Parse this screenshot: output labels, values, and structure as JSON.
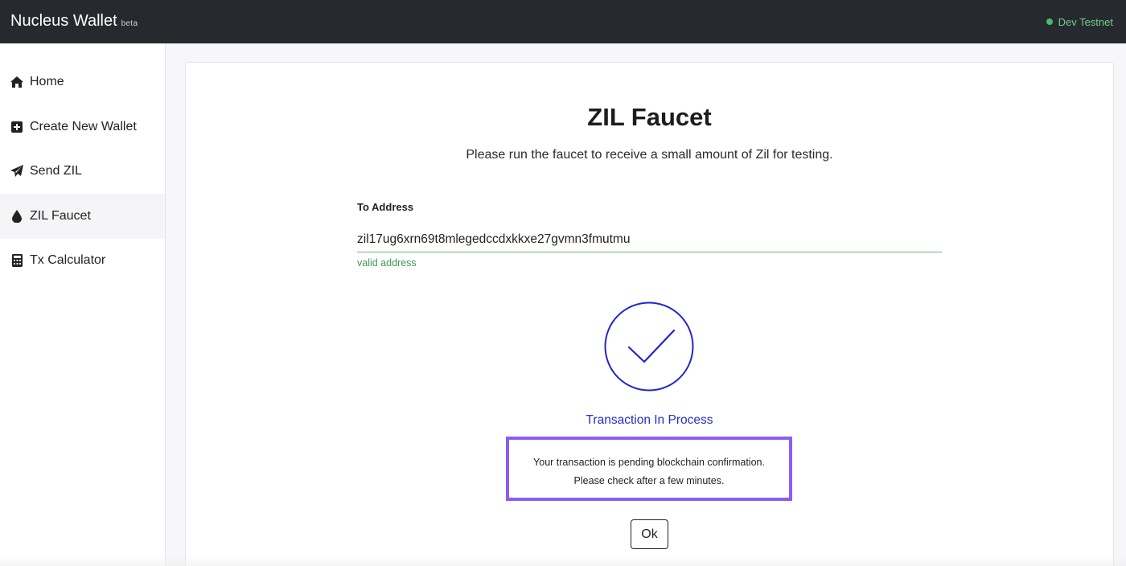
{
  "header": {
    "app_name": "Nucleus Wallet",
    "badge": "beta",
    "network": "Dev Testnet",
    "network_status_color": "#4cbb6e"
  },
  "sidebar": {
    "items": [
      {
        "label": "Home",
        "icon": "home-icon"
      },
      {
        "label": "Create New Wallet",
        "icon": "plus-square-icon"
      },
      {
        "label": "Send ZIL",
        "icon": "paper-plane-icon"
      },
      {
        "label": "ZIL Faucet",
        "icon": "droplet-icon",
        "active": true
      },
      {
        "label": "Tx Calculator",
        "icon": "calculator-icon"
      }
    ]
  },
  "main": {
    "title": "ZIL Faucet",
    "subtitle": "Please run the faucet to receive a small amount of Zil for testing.",
    "address_label": "To Address",
    "address_value": "zil17ug6xrn69t8mlegedccdxkkxe27gvmn3fmutmu",
    "validation_message": "valid address",
    "status_icon": "check-circle-icon",
    "status_text": "Transaction In Process",
    "notice_line1": "Your transaction is pending blockchain confirmation.",
    "notice_line2": "Please check after a few minutes.",
    "ok_label": "Ok"
  },
  "colors": {
    "accent": "#2b2bc4",
    "highlight_border": "#8b5cf6",
    "valid": "#3f9a52",
    "topbar": "#262a2f"
  }
}
